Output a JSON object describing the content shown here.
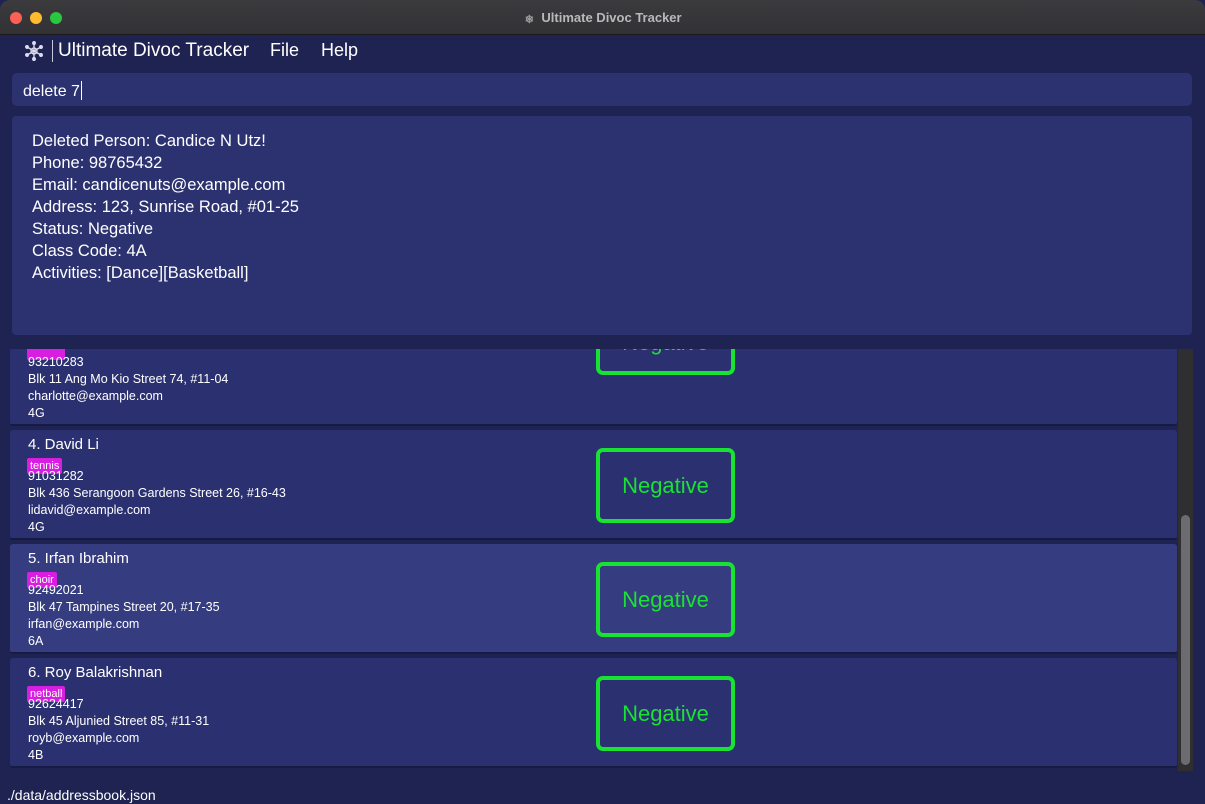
{
  "window": {
    "title": "Ultimate Divoc Tracker"
  },
  "menubar": {
    "app_name": "Ultimate Divoc Tracker",
    "file": "File",
    "help": "Help"
  },
  "command": {
    "value": "delete 7"
  },
  "result": {
    "lines": [
      "Deleted Person: Candice N Utz!",
      "Phone: 98765432",
      "Email: candicenuts@example.com",
      "Address: 123, Sunrise Road, #01-25",
      "Status: Negative",
      "Class Code: 4A",
      "Activities: [Dance][Basketball]"
    ]
  },
  "persons": [
    {
      "name": "",
      "tag": "",
      "phone": "93210283",
      "address": "Blk 11 Ang Mo Kio Street 74, #11-04",
      "email": "charlotte@example.com",
      "class": "4G",
      "status": "Negative"
    },
    {
      "name": "4.  David Li",
      "tag": "tennis",
      "phone": "91031282",
      "address": "Blk 436 Serangoon Gardens Street 26, #16-43",
      "email": "lidavid@example.com",
      "class": "4G",
      "status": "Negative"
    },
    {
      "name": "5.  Irfan Ibrahim",
      "tag": "choir",
      "phone": "92492021",
      "address": "Blk 47 Tampines Street 20, #17-35",
      "email": "irfan@example.com",
      "class": "6A",
      "status": "Negative"
    },
    {
      "name": "6.  Roy Balakrishnan",
      "tag": "netball",
      "phone": "92624417",
      "address": "Blk 45 Aljunied Street 85, #11-31",
      "email": "royb@example.com",
      "class": "4B",
      "status": "Negative"
    }
  ],
  "statusbar": {
    "path": "./data/addressbook.json"
  },
  "colors": {
    "background": "#1f2352",
    "panel": "#2c3270",
    "status_negative": "#19e233",
    "tag": "#d81ee0"
  }
}
